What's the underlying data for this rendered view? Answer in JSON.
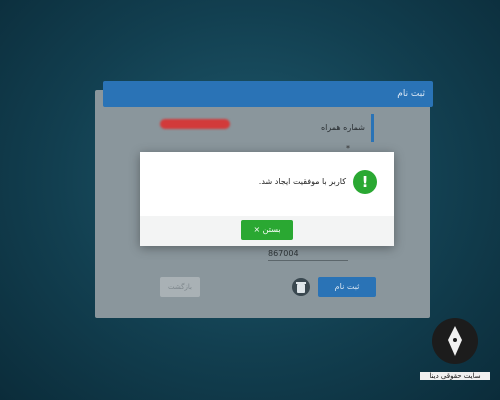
{
  "form": {
    "title": "ثبت نام",
    "phone_label": "شماره همراه",
    "asterisk": "*",
    "code_value": "867004",
    "register_label": "ثبت نام",
    "back_label": "بازگشت"
  },
  "dialog": {
    "icon_symbol": "!",
    "message": "کاربر با موفقیت ایجاد شد.",
    "close_label": "بستن ×"
  },
  "watermark": {
    "text": "سایت حقوقی دینا"
  },
  "colors": {
    "primary": "#2a73b6",
    "success": "#2aa832",
    "redaction": "#d23a3a"
  }
}
